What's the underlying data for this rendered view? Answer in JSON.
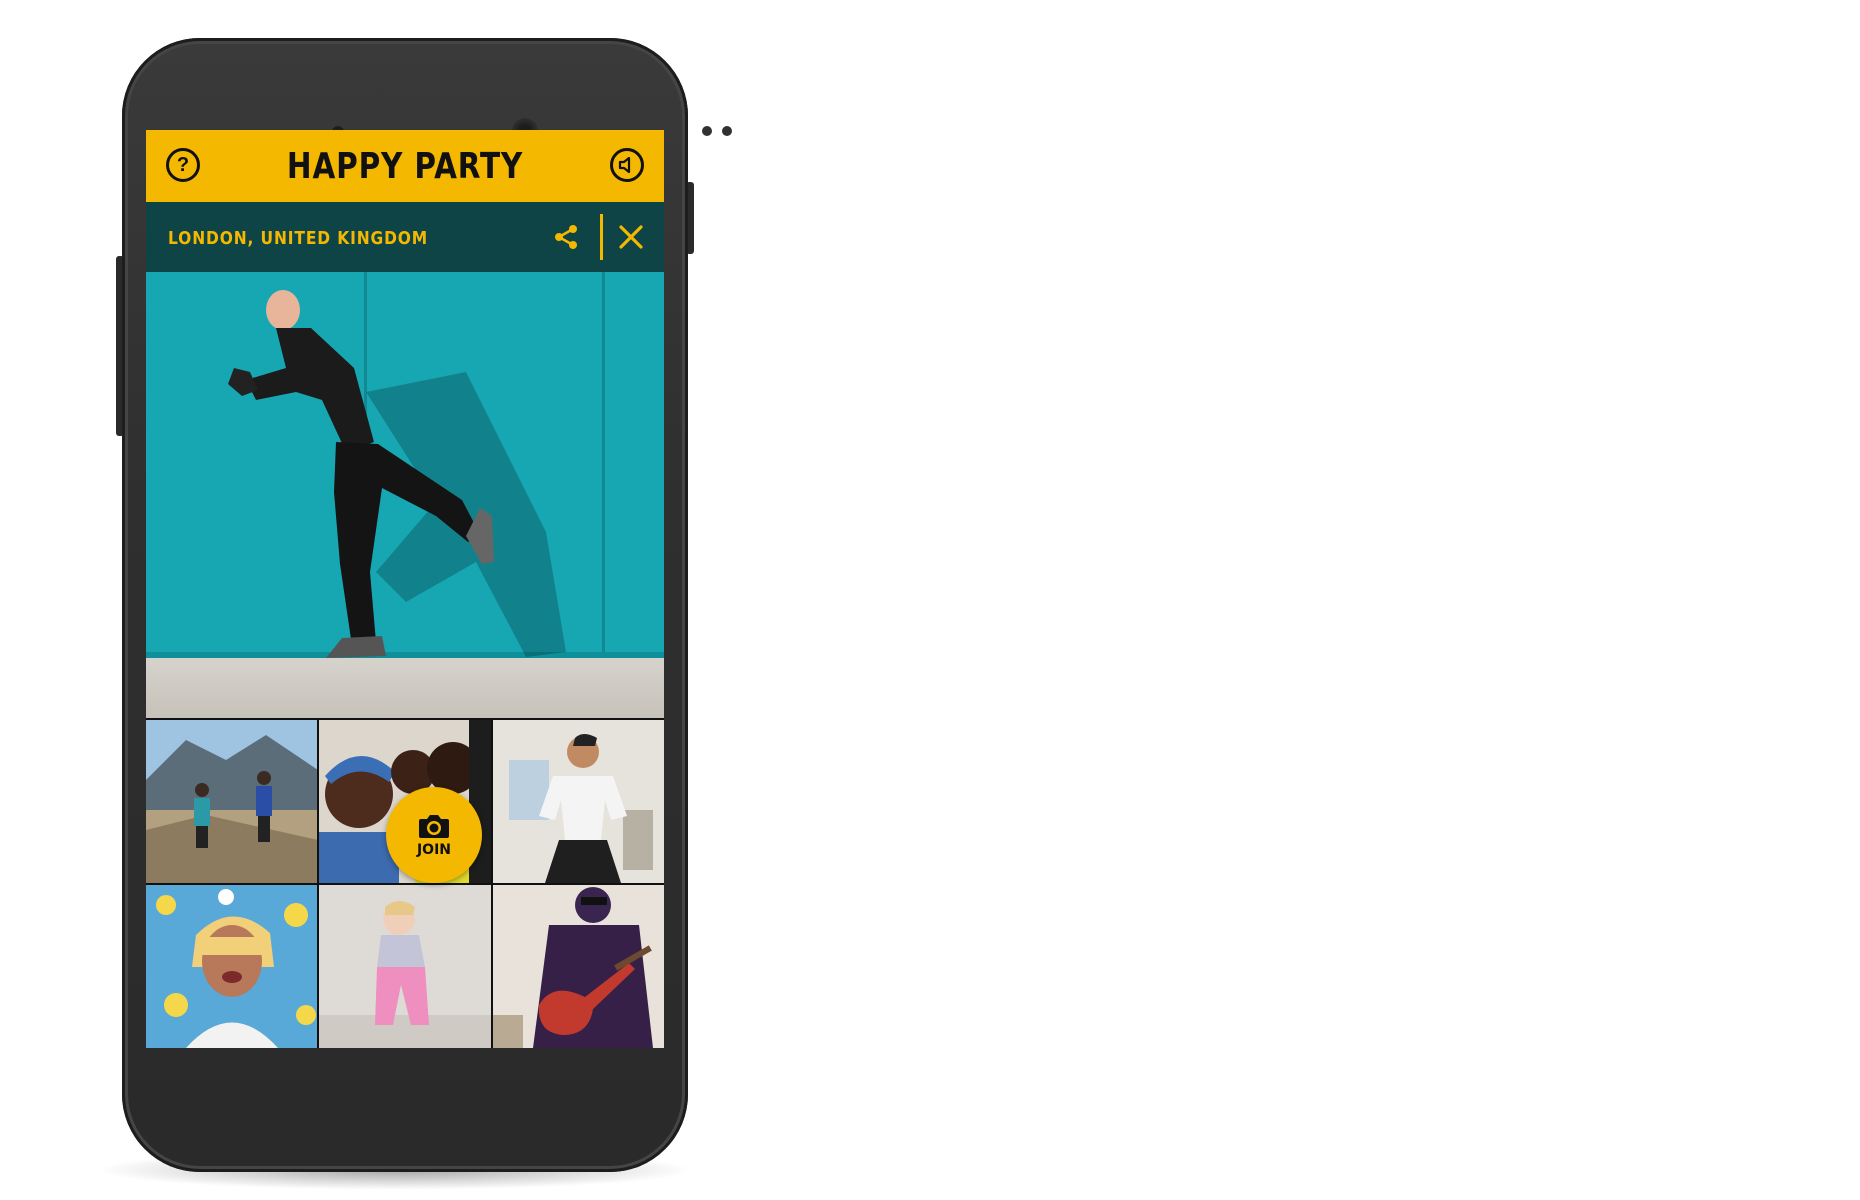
{
  "app": {
    "title": "HAPPY PARTY"
  },
  "header": {
    "help_icon": "help-icon",
    "sound_icon": "speaker-icon",
    "help_glyph": "?"
  },
  "info_bar": {
    "location": "LONDON, UNITED KINGDOM",
    "share_icon": "share-icon",
    "close_icon": "close-icon"
  },
  "videos": [
    {
      "scene": "two women cheering on a mountain"
    },
    {
      "scene": "group of smiling women waving"
    },
    {
      "scene": "young man dancing in a room"
    },
    {
      "scene": "woman with blonde hair against floral wall"
    },
    {
      "scene": "toddler dancing"
    },
    {
      "scene": "person playing electric guitar"
    }
  ],
  "join_button": {
    "label": "JOIN",
    "icon": "camera-icon"
  },
  "colors": {
    "accent": "#f4b800",
    "info_bar": "#0f4446",
    "wall": "#17a7b3"
  }
}
